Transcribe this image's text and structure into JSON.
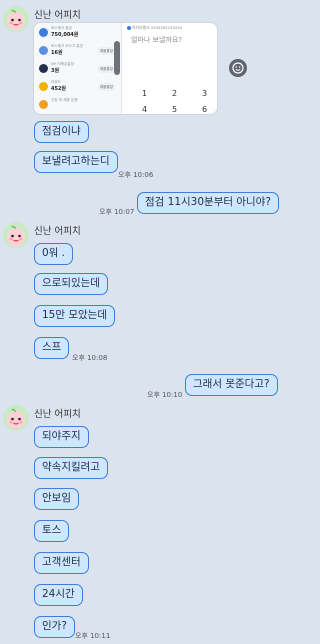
{
  "colors": {
    "background": "#dbe3ee",
    "bubble_fill": "#cfe6ff",
    "bubble_border": "#3f7fd6",
    "avatar_bg": "#c8ebc5"
  },
  "sender_name": "신난 어피치",
  "shared_image": {
    "account_label": "카카오뱅크 3333205233234",
    "question": "얼마나 보낼까요?",
    "keypad": [
      "1",
      "2",
      "3",
      "4",
      "5",
      "6"
    ],
    "rows": [
      {
        "label": "토스뱅크 통장",
        "value": "750,004원",
        "button": "",
        "icon_color": "#3b7ddd"
      },
      {
        "label": "토스뱅크 모으기 통장",
        "value": "16원",
        "button": "채움통장",
        "icon_color": "#5a8fe0"
      },
      {
        "label": "NH 저축금통장",
        "value": "3원",
        "button": "채움통장",
        "icon_color": "#243049"
      },
      {
        "label": "리워드",
        "value": "452원",
        "button": "채움통장",
        "icon_color": "#f0b400"
      },
      {
        "label": "신한 외 제휴 은행",
        "value": "",
        "button": "",
        "icon_color": "#f0a020"
      }
    ]
  },
  "icons": {
    "emoji": "smile-icon",
    "avatar": "peach-avatar-icon"
  },
  "messages": {
    "g1": {
      "m1": "점검이냐",
      "m2": "보낼려고하는디",
      "time": "오후 10:06"
    },
    "r1": {
      "text": "점검 11시30분부터 아니야?",
      "time": "오후 10:07"
    },
    "g2": {
      "m1": "0워 .",
      "m2": "으로되있는데",
      "m3": "15만 모았는데",
      "m4": "스프",
      "time": "오후 10:08"
    },
    "r2": {
      "text": "그래서 못준다고?",
      "time": "오후 10:10"
    },
    "g3": {
      "m1": "되야주지",
      "m2": "약속지킬려고",
      "m3": "안보임",
      "m4": "토스",
      "m5": "고객센터",
      "m6": "24시간",
      "m7": "인가?",
      "time": "오후 10:11"
    }
  }
}
